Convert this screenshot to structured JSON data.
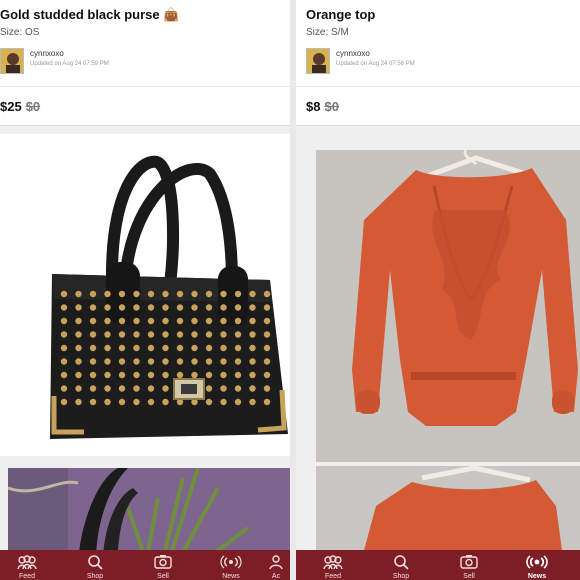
{
  "cards": [
    {
      "title": "Gold studded black purse 👜",
      "size": "Size: OS",
      "seller": "cynnxoxo",
      "updated": "Updated on Aug 24 07:59 PM",
      "price": "$25",
      "original_price": "$0"
    },
    {
      "title": "Orange top",
      "size": "Size: S/M",
      "seller": "cynnxoxo",
      "updated": "Updated on Aug 24 07:56 PM",
      "price": "$8",
      "original_price": "$0"
    }
  ],
  "tabbar": {
    "left": [
      {
        "label": "Feed",
        "icon": "feed-icon"
      },
      {
        "label": "Shop",
        "icon": "search-icon"
      },
      {
        "label": "Sell",
        "icon": "camera-icon"
      },
      {
        "label": "News",
        "icon": "broadcast-icon"
      },
      {
        "label": "Ac",
        "icon": "account-icon"
      }
    ],
    "right": [
      {
        "label": "Feed",
        "icon": "feed-icon"
      },
      {
        "label": "Shop",
        "icon": "search-icon"
      },
      {
        "label": "Sell",
        "icon": "camera-icon"
      },
      {
        "label": "News",
        "icon": "broadcast-icon",
        "active": true
      }
    ]
  },
  "colors": {
    "tabbar": "#7d1e26",
    "top_orange": "#d45a35",
    "bag_black": "#1c1c1c",
    "stud_gold": "#c8a25a"
  }
}
